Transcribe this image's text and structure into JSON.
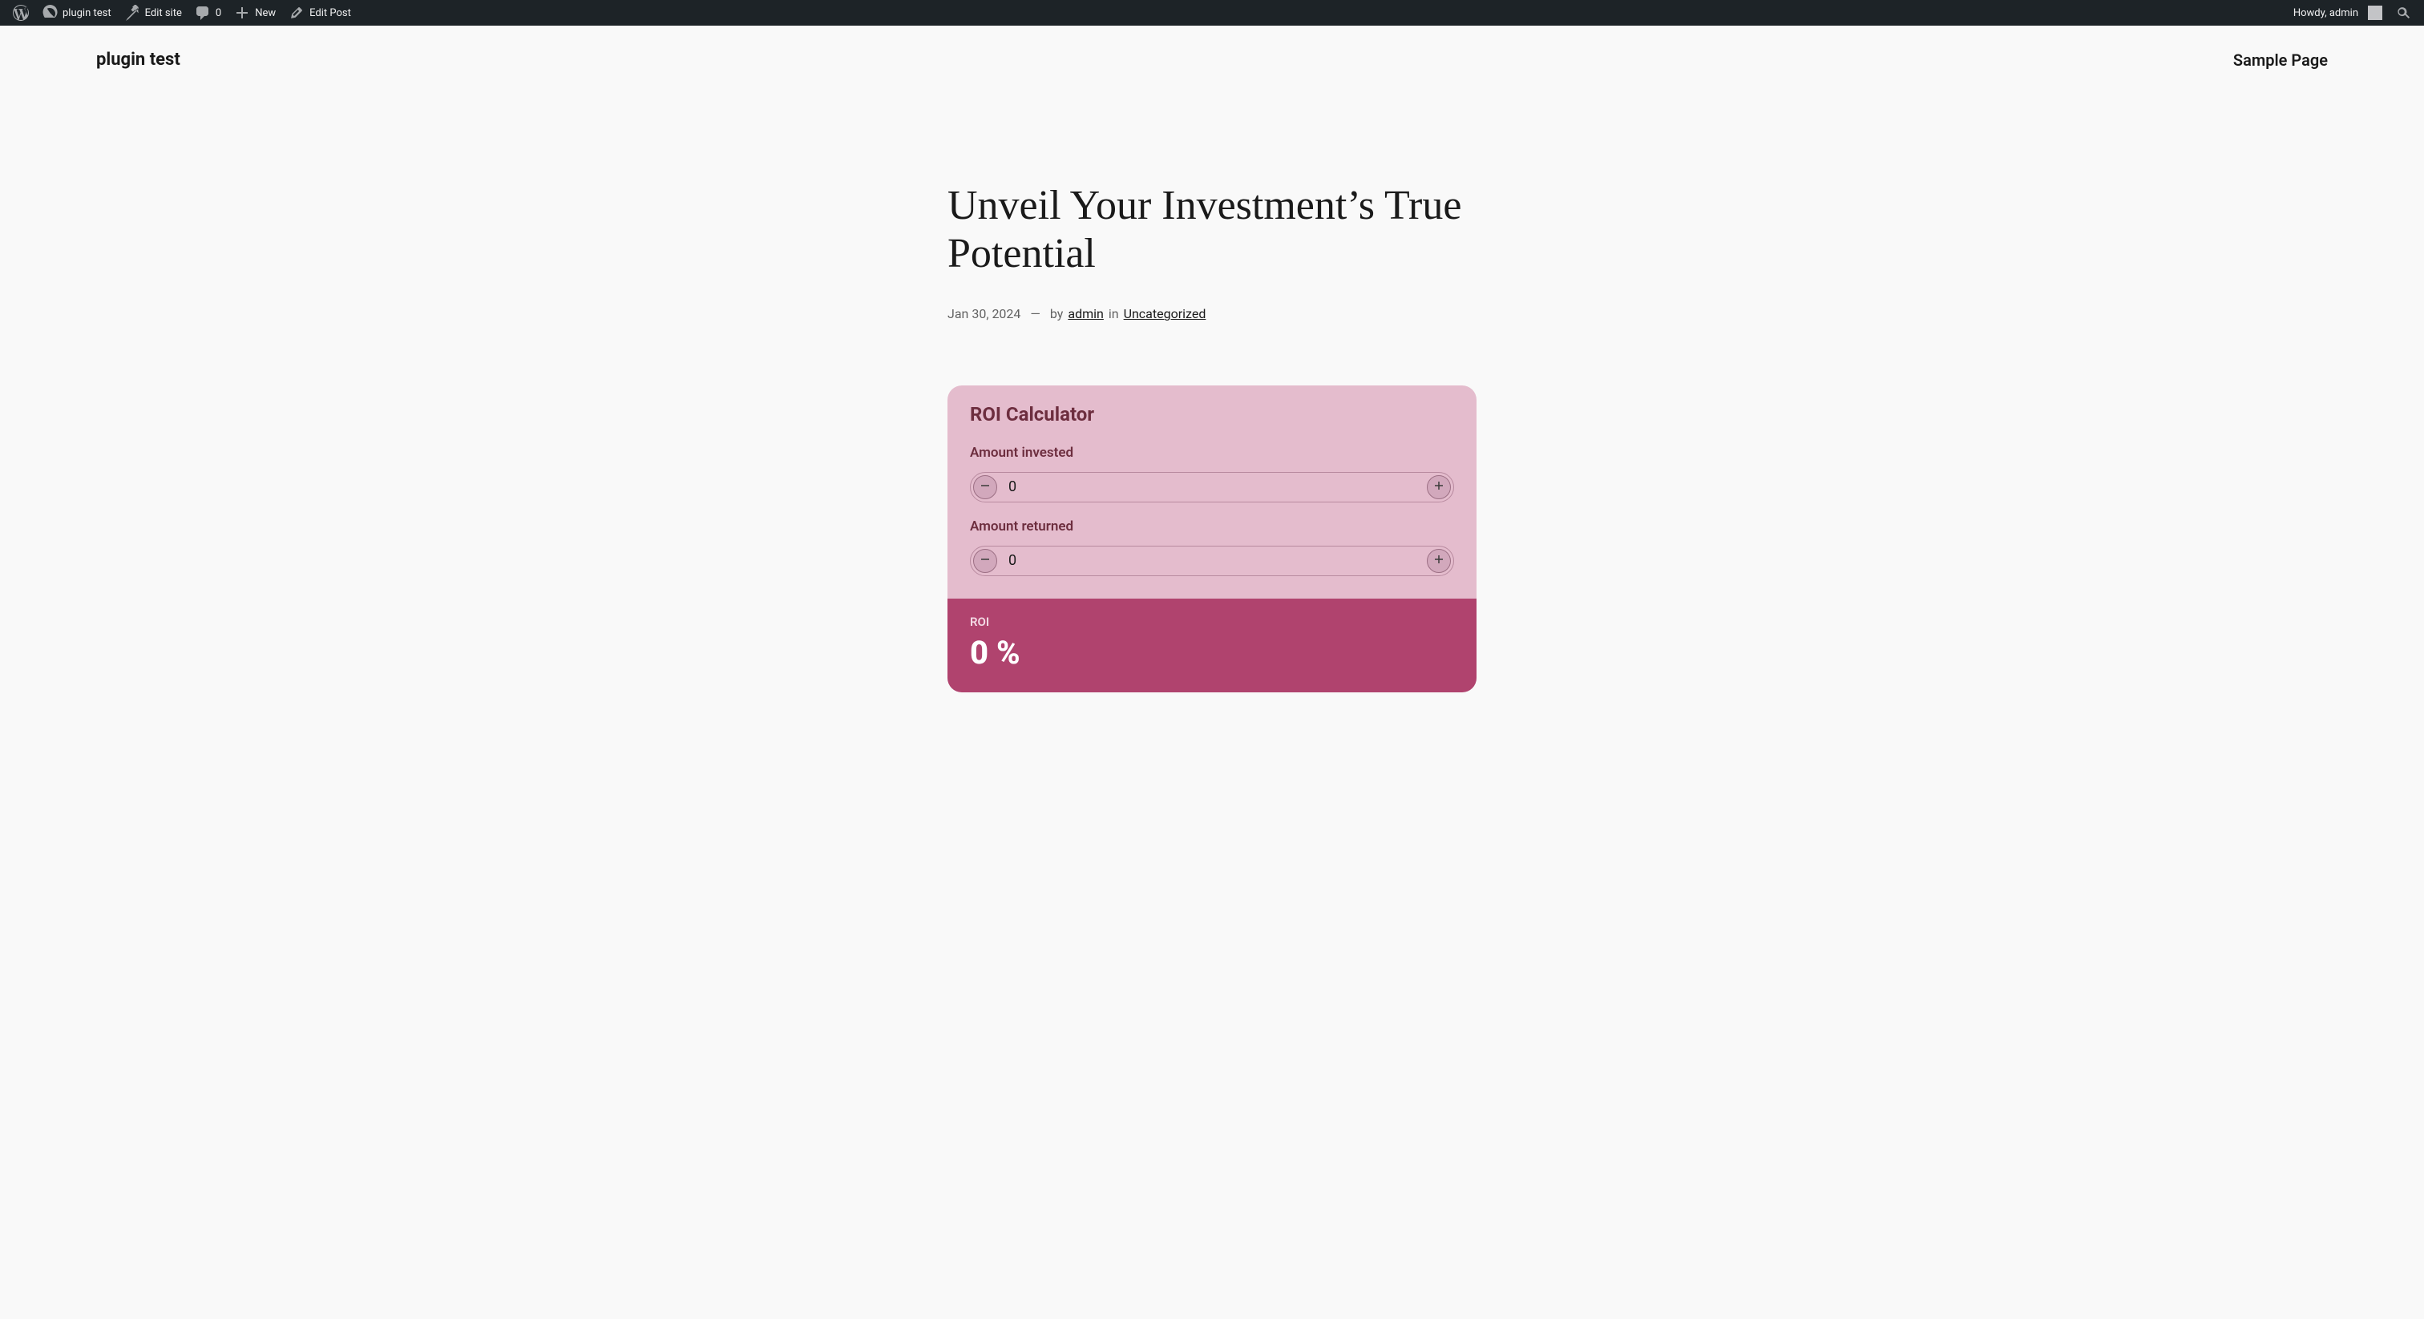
{
  "adminbar": {
    "site_name": "plugin test",
    "edit_site": "Edit site",
    "comments_count": "0",
    "new_label": "New",
    "edit_post": "Edit Post",
    "howdy": "Howdy, admin"
  },
  "header": {
    "site_title": "plugin test",
    "nav_item": "Sample Page"
  },
  "post": {
    "title": "Unveil Your Investment’s True Potential",
    "date": "Jan 30, 2024",
    "by_label": "by",
    "author": "admin",
    "in_label": "in",
    "category": "Uncategorized"
  },
  "calculator": {
    "title": "ROI Calculator",
    "invested_label": "Amount invested",
    "invested_value": "0",
    "returned_label": "Amount returned",
    "returned_value": "0",
    "result_label": "ROI",
    "result_value": "0 %"
  }
}
